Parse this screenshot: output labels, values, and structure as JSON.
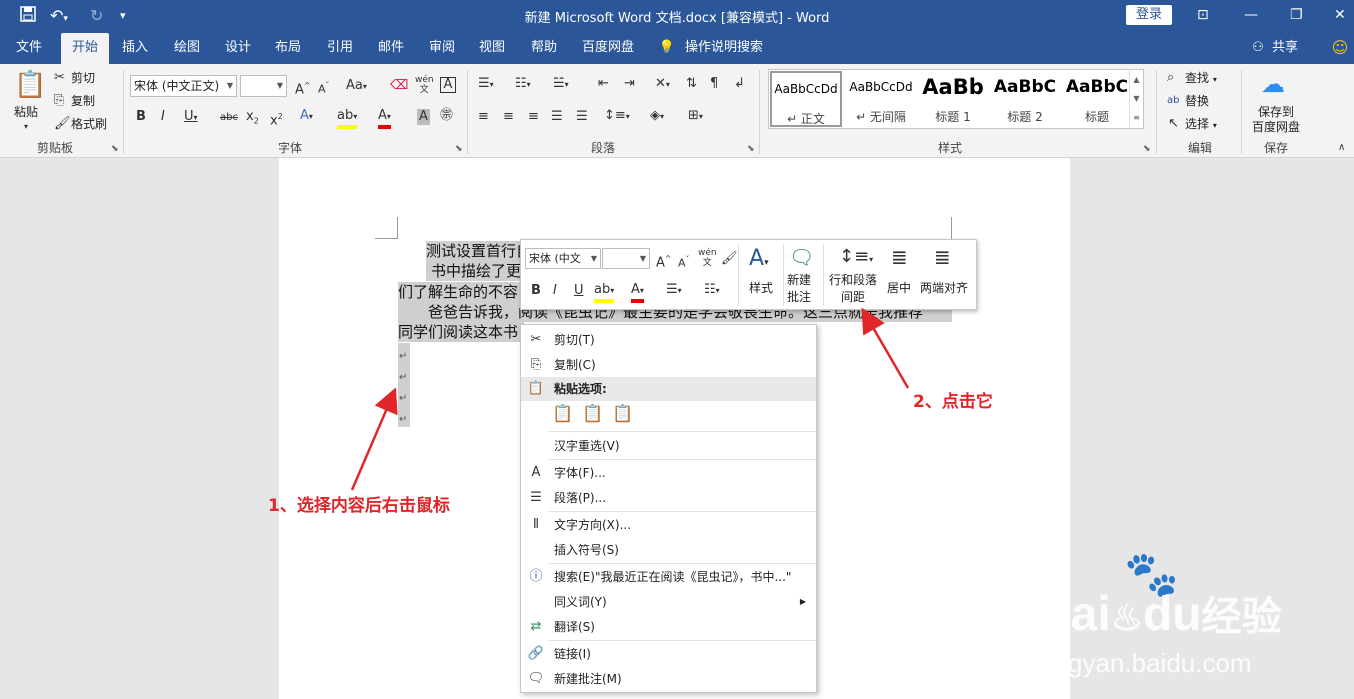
{
  "titlebar": {
    "title": "新建 Microsoft Word 文档.docx [兼容模式]  -  Word",
    "login": "登录",
    "save_icon": "floppy-icon",
    "undo_icon": "undo-icon",
    "redo_icon": "redo-icon"
  },
  "tabs": [
    "文件",
    "开始",
    "插入",
    "绘图",
    "设计",
    "布局",
    "引用",
    "邮件",
    "审阅",
    "视图",
    "帮助",
    "百度网盘"
  ],
  "tellme": "操作说明搜索",
  "share": "共享",
  "clipboard": {
    "paste": "粘贴",
    "cut": "剪切",
    "copy": "复制",
    "format_painter": "格式刷",
    "label": "剪贴板"
  },
  "font": {
    "name": "宋体 (中文正文)",
    "size": "",
    "label": "字体",
    "aa": "Aa",
    "wen": "wén",
    "wen2": "文"
  },
  "paragraph": {
    "label": "段落"
  },
  "styles": {
    "label": "样式",
    "items": [
      {
        "preview": "AaBbCcDd",
        "name": "↵ 正文"
      },
      {
        "preview": "AaBbCcDd",
        "name": "↵ 无间隔"
      },
      {
        "preview": "AaBb",
        "name": "标题 1"
      },
      {
        "preview": "AaBbC",
        "name": "标题 2"
      },
      {
        "preview": "AaBbC",
        "name": "标题"
      }
    ]
  },
  "editing": {
    "find": "查找",
    "replace": "替换",
    "select": "选择",
    "label": "编辑"
  },
  "save": {
    "line1": "保存到",
    "line2": "百度网盘",
    "label": "保存"
  },
  "document": {
    "lines": [
      "测试设置首行自",
      "书中描绘了更",
      "们了解生命的不容",
      "爸爸告诉我，阅读《昆虫记》最主要的是学会敬畏生命。这三点就是我推荐",
      "同学们阅读这本书"
    ],
    "pilcrow": "↵"
  },
  "mini_toolbar": {
    "font": "宋体 (中文",
    "size": "",
    "styles": "样式",
    "new_comment_1": "新建",
    "new_comment_2": "批注",
    "line_spacing_1": "行和段落",
    "line_spacing_2": "间距",
    "center": "居中",
    "justify": "两端对齐",
    "bold": "B",
    "italic": "I",
    "underline": "U",
    "font_color": "A",
    "wen": "wén"
  },
  "context_menu": {
    "cut": "剪切(T)",
    "copy": "复制(C)",
    "paste_options": "粘贴选项:",
    "reconvert": "汉字重选(V)",
    "font": "字体(F)...",
    "paragraph": "段落(P)...",
    "text_direction": "文字方向(X)...",
    "insert_symbol": "插入符号(S)",
    "search": "搜索(E)\"我最近正在阅读《昆虫记》，书中...\"",
    "synonyms": "同义词(Y)",
    "translate": "翻译(S)",
    "link": "链接(I)",
    "new_comment": "新建批注(M)"
  },
  "annotations": {
    "step1": "1、选择内容后右击鼠标",
    "step2": "2、点击它"
  },
  "watermark": {
    "brand": "Bai",
    "brand2": "du",
    "cn": "经验",
    "url": "jingyan.baidu.com"
  },
  "colors": {
    "word_blue": "#2b579a",
    "annotation_red": "#e0262b"
  }
}
